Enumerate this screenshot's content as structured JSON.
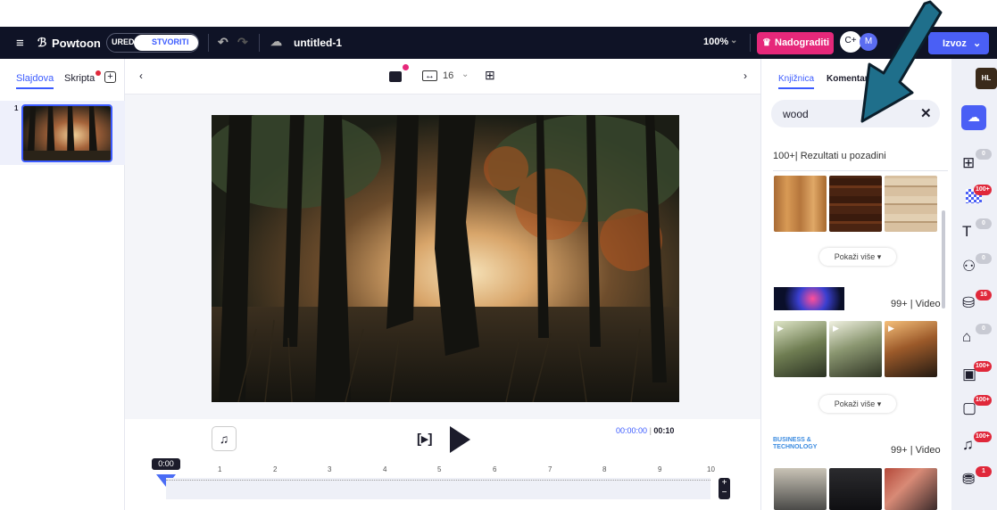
{
  "topbar": {
    "brand": "Powtoon",
    "mode_edit": "UREDI",
    "mode_create": "STVORITI",
    "doc_title": "untitled-1",
    "zoom": "100%",
    "upgrade_label": "Nadograditi",
    "avatar_initial": "M",
    "export_label": "Izvoz"
  },
  "left": {
    "tab_slides": "Slajdova",
    "tab_script": "Skripta",
    "slide_number": "1"
  },
  "toolbar": {
    "font_size": "16"
  },
  "player": {
    "time_current": "00:00:00",
    "time_total": "00:10"
  },
  "timeline": {
    "playhead": "0:00",
    "ticks": [
      "1",
      "2",
      "3",
      "4",
      "5",
      "6",
      "7",
      "8",
      "9",
      "10"
    ]
  },
  "right": {
    "tab_library": "Knjižnica",
    "tab_comments": "Komentari",
    "search_value": "wood",
    "bg_results": "100+| Rezultati u pozadini",
    "show_more": "Pokaži više",
    "video_results": "99+ | Video",
    "category_label": "BUSINESS & TECHNOLOGY",
    "video_results2": "99+ | Video"
  },
  "sidebar": {
    "badges": [
      "0",
      "100+",
      "0",
      "0",
      "16",
      "0",
      "100+",
      "100+",
      "100+",
      "1"
    ]
  },
  "profile": {
    "initials": "HL"
  },
  "colors": {
    "accent": "#3b5bff",
    "brand_dark": "#0f1326",
    "upgrade": "#e6287a",
    "arrow": "#1f6f8b"
  }
}
